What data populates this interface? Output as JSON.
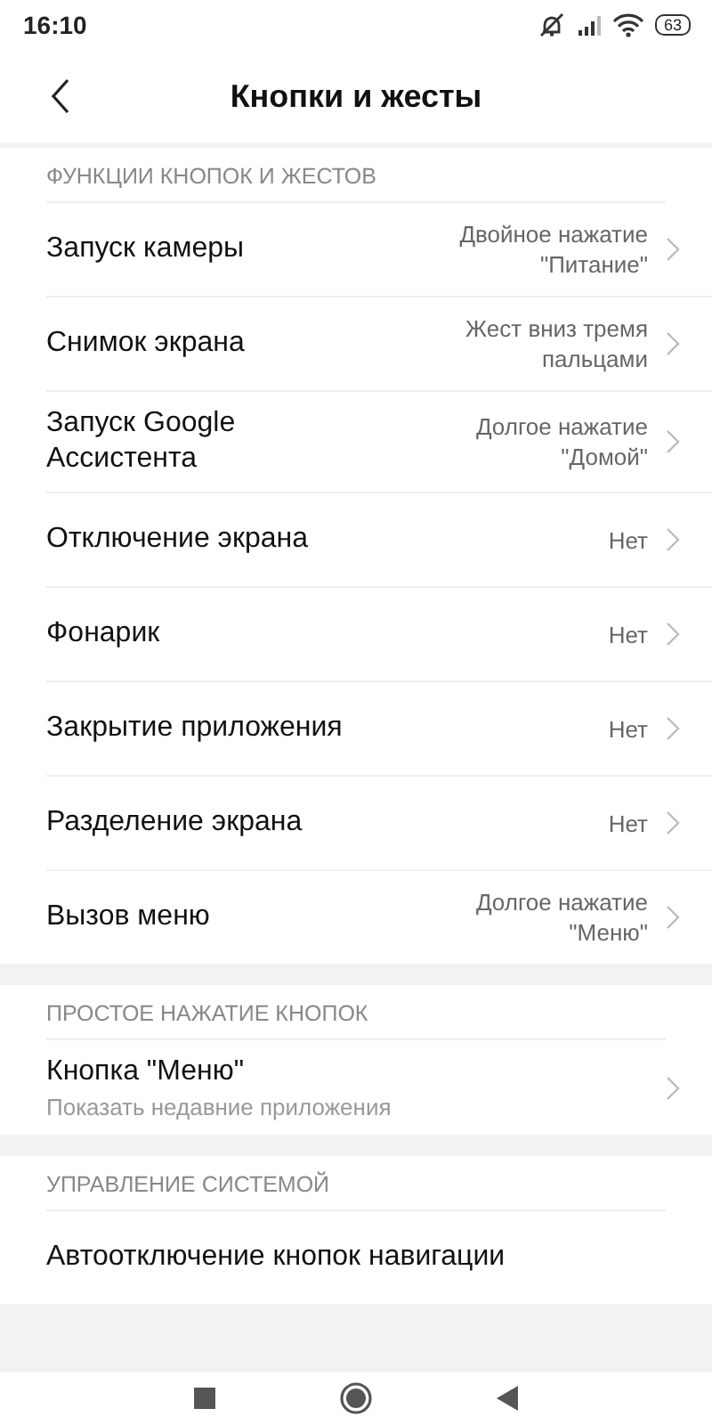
{
  "status_bar": {
    "time": "16:10",
    "battery": "63"
  },
  "header": {
    "title": "Кнопки и жесты"
  },
  "sections": [
    {
      "title": "ФУНКЦИИ КНОПОК И ЖЕСТОВ",
      "items": [
        {
          "title": "Запуск камеры",
          "value": "Двойное нажатие\n\"Питание\""
        },
        {
          "title": "Снимок экрана",
          "value": "Жест вниз тремя\nпальцами"
        },
        {
          "title": "Запуск Google\nАссистента",
          "value": "Долгое нажатие\n\"Домой\""
        },
        {
          "title": "Отключение экрана",
          "value": "Нет"
        },
        {
          "title": "Фонарик",
          "value": "Нет"
        },
        {
          "title": "Закрытие приложения",
          "value": "Нет"
        },
        {
          "title": "Разделение экрана",
          "value": "Нет"
        },
        {
          "title": "Вызов меню",
          "value": "Долгое нажатие\n\"Меню\""
        }
      ]
    },
    {
      "title": "ПРОСТОЕ НАЖАТИЕ КНОПОК",
      "items": [
        {
          "title": "Кнопка \"Меню\"",
          "subtitle": "Показать недавние приложения"
        }
      ]
    },
    {
      "title": "УПРАВЛЕНИЕ СИСТЕМОЙ",
      "items": [
        {
          "title": "Автоотключение кнопок навигации"
        }
      ]
    }
  ]
}
